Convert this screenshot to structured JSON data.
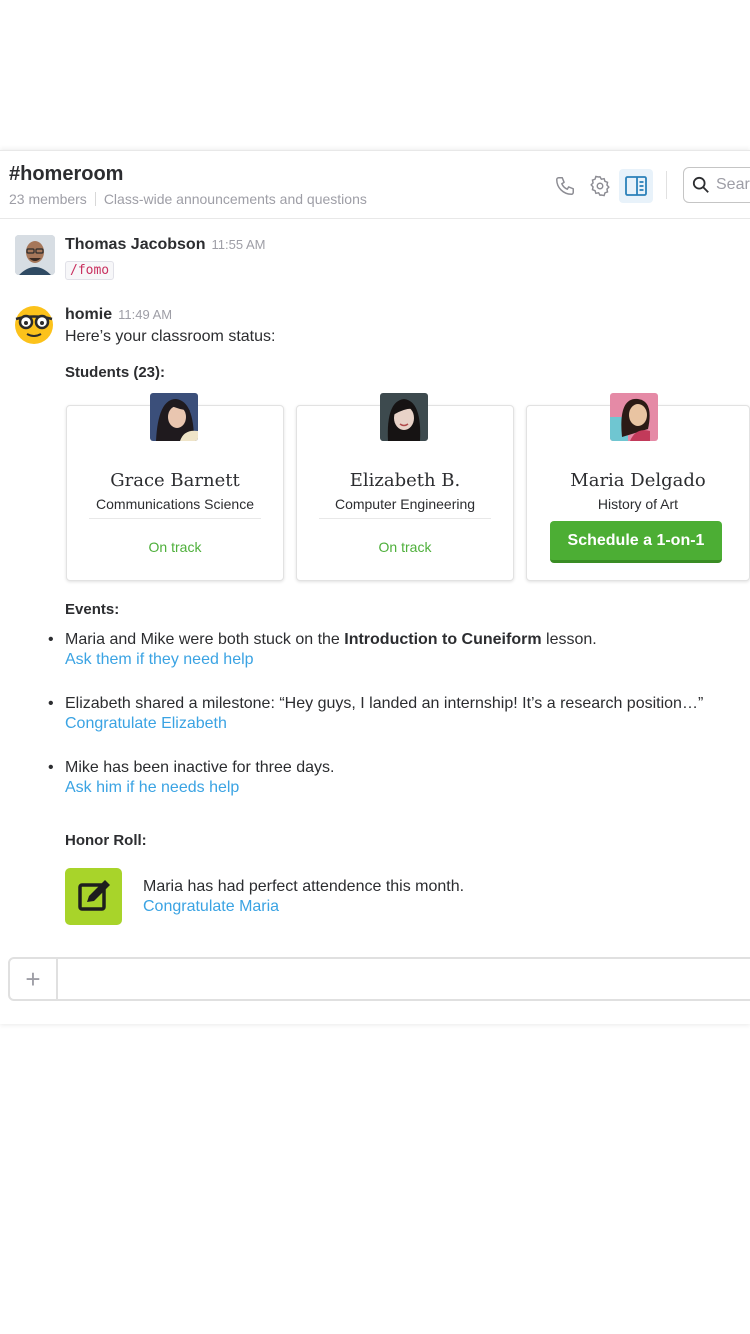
{
  "channel": {
    "name": "#homeroom",
    "members": "23 members",
    "topic": "Class-wide announcements and questions",
    "search_placeholder": "Sear"
  },
  "header_icons": [
    "phone-icon",
    "gear-icon",
    "sidebar-toggle-icon",
    "search-icon"
  ],
  "messages": [
    {
      "sender": "Thomas Jacobson",
      "time": "11:55 AM",
      "command": "/fomo"
    },
    {
      "sender": "homie",
      "time": "11:49 AM",
      "intro": "Here’s your classroom status:"
    }
  ],
  "students": {
    "heading": "Students (23):",
    "cards": [
      {
        "name": "Grace Barnett",
        "major": "Communications Science",
        "status": "On track"
      },
      {
        "name": "Elizabeth B.",
        "major": "Computer Engineering",
        "status": "On track"
      },
      {
        "name": "Maria Delgado",
        "major": "History of Art",
        "action": "Schedule a 1-on-1"
      }
    ]
  },
  "events": {
    "heading": "Events:",
    "items": [
      {
        "pre": "Maria and Mike were both stuck on the ",
        "bold": "Introduction to Cuneiform",
        "post": " lesson.",
        "link": "Ask them if they need help"
      },
      {
        "pre": "Elizabeth shared a milestone: “Hey guys, I landed an internship! It’s a research position…”",
        "link": "Congratulate Elizabeth"
      },
      {
        "pre": "Mike has been inactive for three days.",
        "link": "Ask him if he needs help"
      }
    ]
  },
  "honor_roll": {
    "heading": "Honor Roll:",
    "text": "Maria has had perfect attendence this month.",
    "link": "Congratulate Maria"
  },
  "composer": {
    "plus": "+"
  },
  "colors": {
    "link": "#3aa3e3",
    "on_track": "#4daf3a",
    "button": "#4cae34",
    "honor_icon": "#a8d42a"
  }
}
